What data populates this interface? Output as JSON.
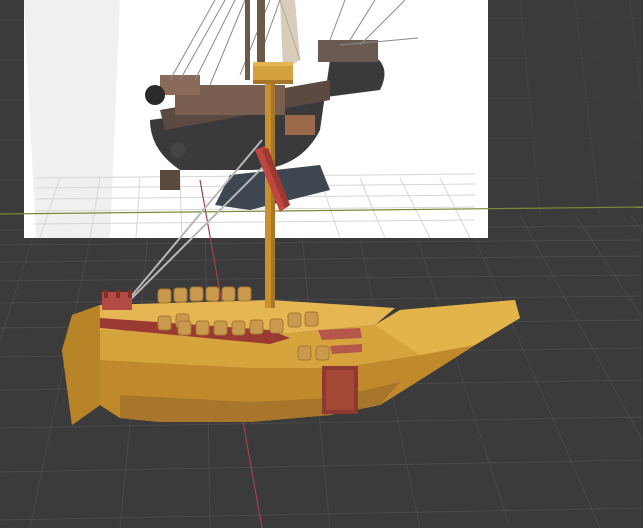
{
  "scene": {
    "view": "3d-viewport",
    "background_color": "#3b3b3b",
    "grid_line_color": "#4a4a4a",
    "x_axis_color": "#7a8a3a",
    "y_axis_color": "#a04050",
    "reference_image": {
      "subject": "sailing-ship-photo",
      "background_color": "#ffffff"
    },
    "model": {
      "subject": "low-poly-cog-ship",
      "hull_color": "#d4a23c",
      "hull_shadow_color": "#a8762a",
      "trim_color": "#9b3a32",
      "mast_color": "#c8922e",
      "barrel_color": "#c99a4e",
      "rope_color": "#b8b8b8"
    }
  }
}
